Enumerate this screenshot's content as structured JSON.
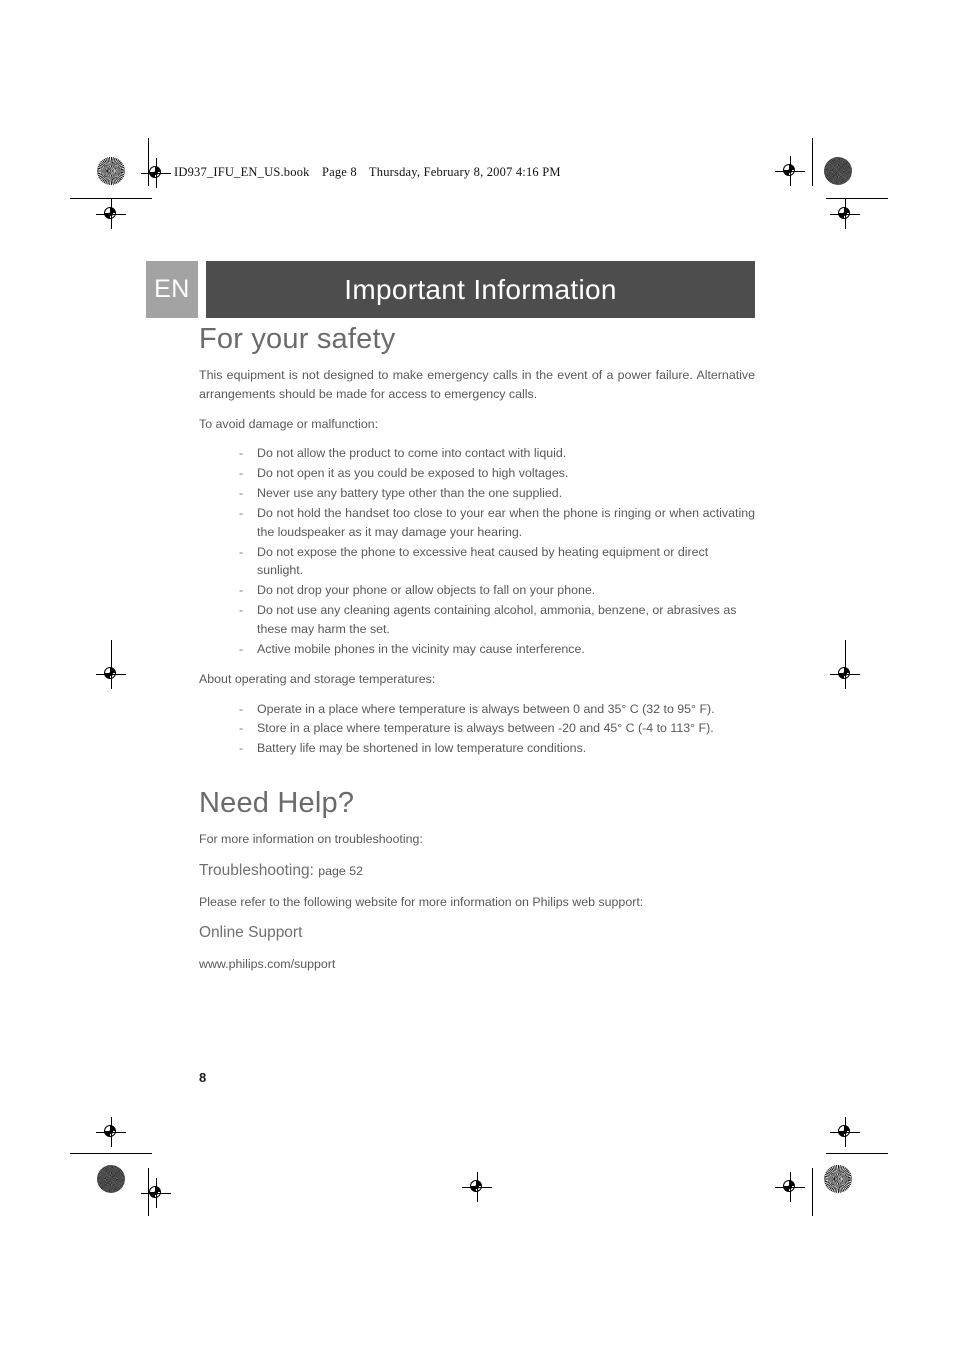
{
  "print_header": {
    "filename": "ID937_IFU_EN_US.book",
    "page_label": "Page 8",
    "timestamp": "Thursday, February 8, 2007  4:16 PM"
  },
  "titlebar": {
    "language_badge": "EN",
    "title": "Important Information"
  },
  "sections": [
    {
      "heading": "For your safety",
      "intro": "This equipment is not designed to make emergency calls in the event of a power failure. Alternative arrangements should be made for access to emergency calls.",
      "lead_1": "To avoid damage or malfunction:",
      "bullets_1": [
        "Do not allow the product to come into contact with liquid.",
        "Do not open it as you could be exposed to high voltages.",
        "Never use any battery type other than the one supplied.",
        "Do not hold the handset too close to your ear when the phone is ringing or when activating the loudspeaker as it may damage your hearing.",
        "Do not expose the phone to excessive heat caused by heating equipment or direct sunlight.",
        "Do not drop your phone or allow objects to fall on your phone.",
        "Do not use any cleaning agents containing alcohol, ammonia, benzene, or abrasives as these may harm the set.",
        "Active mobile phones in the vicinity may cause interference."
      ],
      "lead_2": "About operating and storage temperatures:",
      "bullets_2": [
        "Operate in a place where temperature is always between 0 and 35° C (32 to 95° F).",
        "Store in a place where temperature is always between -20 and 45° C (-4 to 113° F).",
        "Battery life may be shortened in low temperature conditions."
      ]
    },
    {
      "heading": "Need Help?",
      "intro": "For more information on troubleshooting:",
      "ref_label": "Troubleshooting:",
      "ref_page": "page 52",
      "web_intro": "Please refer to the following website for more information on Philips web support:",
      "web_label": "Online Support",
      "web_url": "www.philips.com/support"
    }
  ],
  "footer": {
    "page_number": "8"
  },
  "colors": {
    "title_band": "#4d4d4d",
    "lang_badge": "#a3a3a3",
    "heading_text": "#6b6b6b",
    "body_text": "#595959"
  }
}
